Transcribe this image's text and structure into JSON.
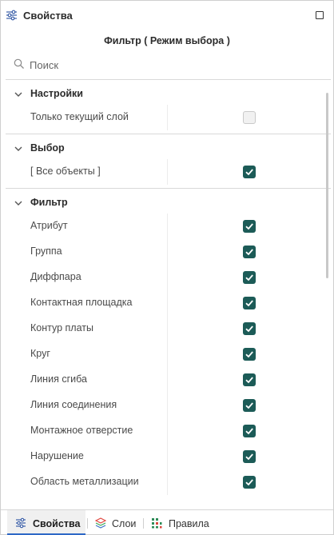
{
  "panel": {
    "title": "Свойства",
    "title_icon": "sliders-icon",
    "maximize_icon": "maximize-icon"
  },
  "subtitle": "Фильтр ( Режим выбора )",
  "search": {
    "placeholder": "Поиск",
    "value": "",
    "icon": "search-icon"
  },
  "sections": {
    "settings": {
      "title": "Настройки",
      "expanded": true,
      "rows": [
        {
          "label": "Только текущий слой",
          "checked": false
        }
      ]
    },
    "selection": {
      "title": "Выбор",
      "expanded": true,
      "rows": [
        {
          "label": "[ Все объекты ]",
          "checked": true
        }
      ]
    },
    "filter": {
      "title": "Фильтр",
      "expanded": true,
      "rows": [
        {
          "label": "Атрибут",
          "checked": true
        },
        {
          "label": "Группа",
          "checked": true
        },
        {
          "label": "Диффпара",
          "checked": true
        },
        {
          "label": "Контактная площадка",
          "checked": true
        },
        {
          "label": "Контур платы",
          "checked": true
        },
        {
          "label": "Круг",
          "checked": true
        },
        {
          "label": "Линия сгиба",
          "checked": true
        },
        {
          "label": "Линия соединения",
          "checked": true
        },
        {
          "label": "Монтажное отверстие",
          "checked": true
        },
        {
          "label": "Нарушение",
          "checked": true
        },
        {
          "label": "Область металлизации",
          "checked": true
        }
      ]
    }
  },
  "tabs": [
    {
      "label": "Свойства",
      "icon": "sliders-icon",
      "active": true
    },
    {
      "label": "Слои",
      "icon": "layers-icon",
      "active": false
    },
    {
      "label": "Правила",
      "icon": "rules-grid-icon",
      "active": false
    }
  ],
  "colors": {
    "checkbox_checked": "#1c5b57",
    "checkbox_unchecked": "#f1f1f1",
    "active_tab_underline": "#2e68c6",
    "layers_icon_red": "#e0433b",
    "layers_icon_green": "#3aa757",
    "layers_icon_blue": "#3b73c8",
    "rules_icon_green": "#2e8b57",
    "rules_icon_red": "#d9463b"
  }
}
